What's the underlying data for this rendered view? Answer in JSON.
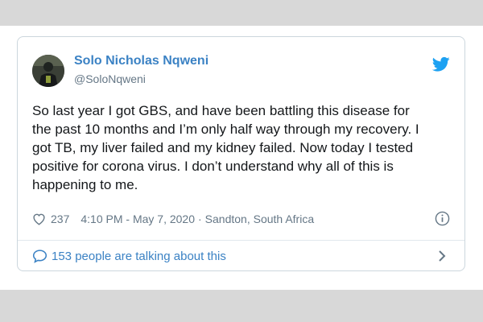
{
  "page": {
    "background_color": "#ffffff",
    "band_color": "#d8d8d8"
  },
  "tweet": {
    "author_name": "Solo Nicholas Nqweni",
    "author_handle": "@SoloNqweni",
    "text_lines": [
      "So last year I got GBS, and have been battling this disease for",
      "the past 10 months and I’m only half way through my recovery. I",
      "got TB, my liver failed and my kidney failed. Now today I tested",
      "positive for corona virus. I don’t understand why all of this is",
      "happening to me."
    ],
    "like_count": "237",
    "timestamp": "4:10 PM - May 7, 2020",
    "separator": "·",
    "location": "Sandton, South Africa",
    "talking_text": "153 people are talking about this",
    "icons": {
      "avatar": "avatar",
      "brand": "twitter-bird-icon",
      "like": "heart-icon",
      "info": "info-icon",
      "talking": "speech-bubble-icon",
      "more": "chevron-right-icon"
    },
    "colors": {
      "accent": "#3b82c4",
      "brand": "#1da1f2",
      "muted": "#657786",
      "text": "#14171a",
      "border": "#ccd6dd"
    }
  }
}
